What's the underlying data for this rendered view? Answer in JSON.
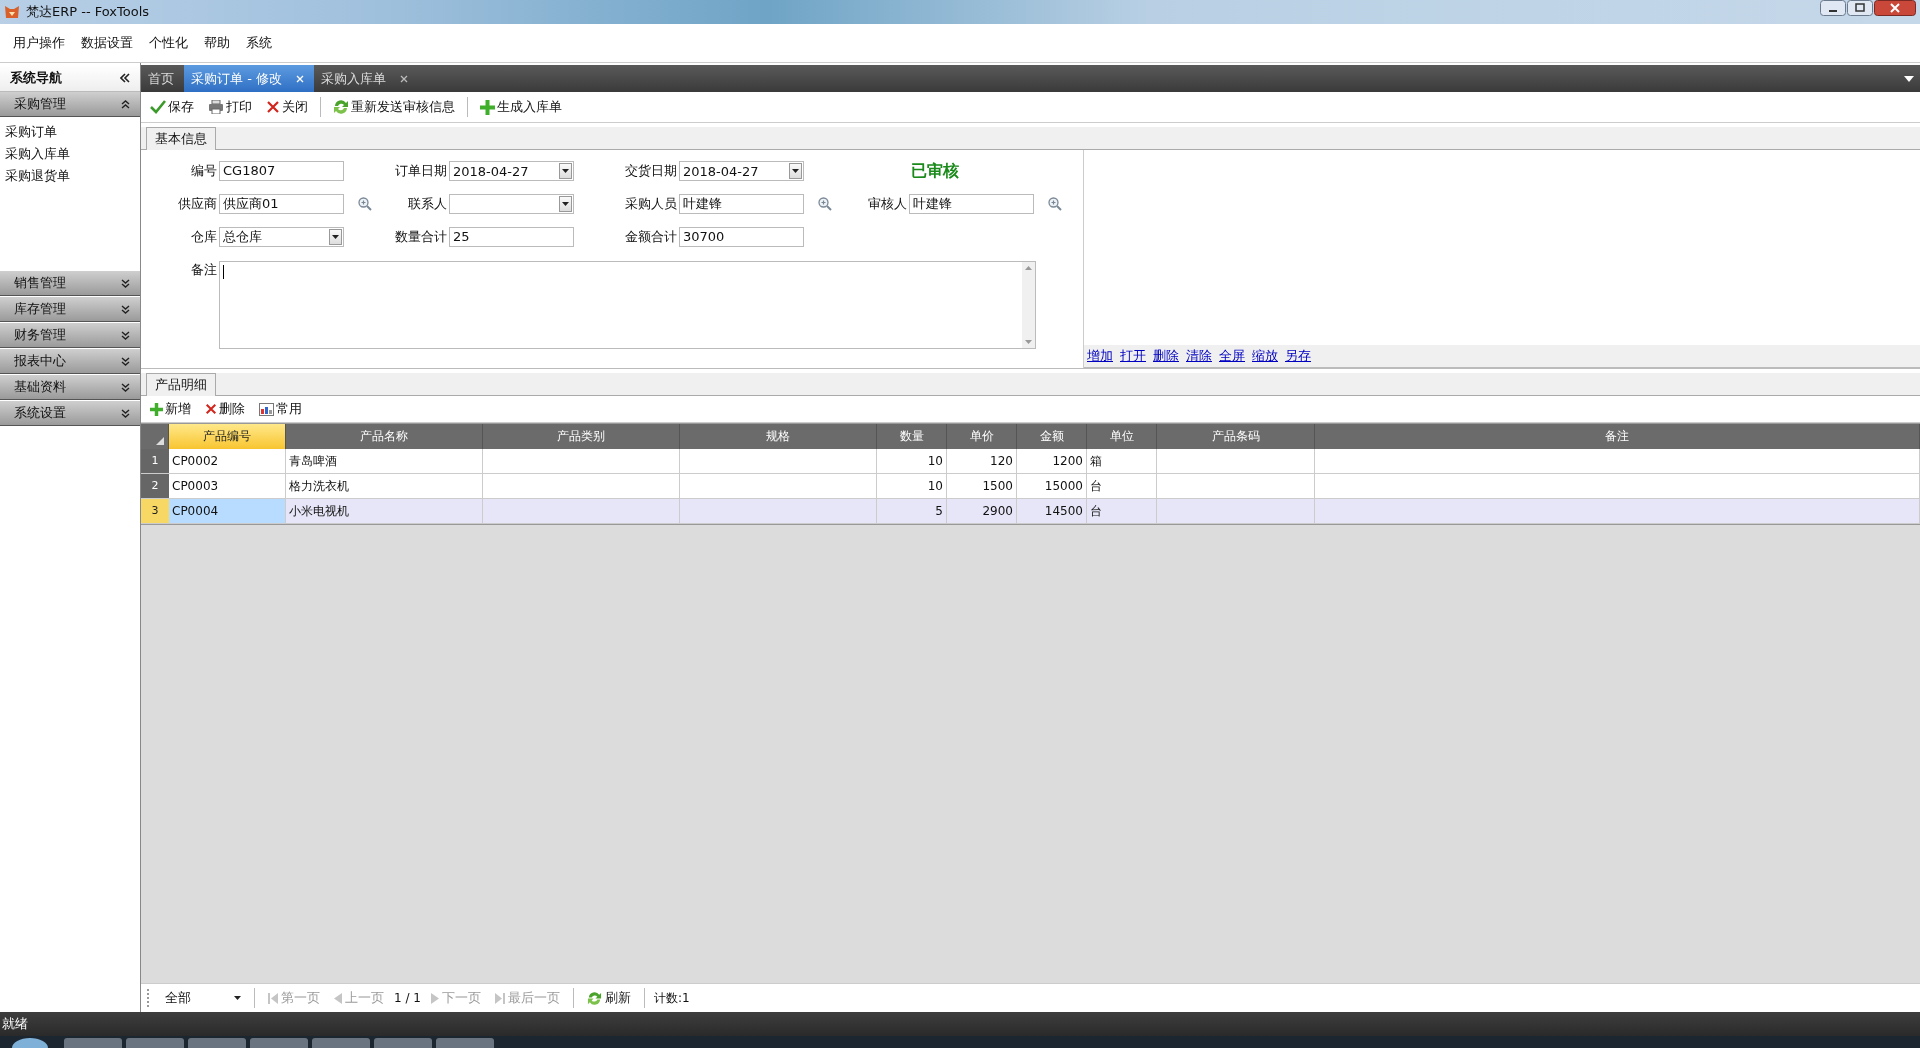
{
  "window": {
    "title": "梵达ERP -- FoxTools"
  },
  "menu": [
    "用户操作",
    "数据设置",
    "个性化",
    "帮助",
    "系统"
  ],
  "sidebar": {
    "title": "系统导航",
    "groups": [
      {
        "label": "采购管理",
        "expanded": true,
        "items": [
          "采购订单",
          "采购入库单",
          "采购退货单"
        ]
      },
      {
        "label": "销售管理",
        "expanded": false
      },
      {
        "label": "库存管理",
        "expanded": false
      },
      {
        "label": "财务管理",
        "expanded": false
      },
      {
        "label": "报表中心",
        "expanded": false
      },
      {
        "label": "基础资料",
        "expanded": false
      },
      {
        "label": "系统设置",
        "expanded": false
      }
    ]
  },
  "tabs": [
    {
      "label": "首页",
      "selected": false,
      "closable": false
    },
    {
      "label": "采购订单 - 修改",
      "selected": true,
      "closable": true
    },
    {
      "label": "采购入库单",
      "selected": false,
      "closable": true
    }
  ],
  "toolbar": {
    "groups": [
      [
        {
          "label": "保存",
          "kind": "save"
        },
        {
          "label": "打印",
          "kind": "print"
        },
        {
          "label": "关闭",
          "kind": "close"
        }
      ],
      [
        {
          "label": "重新发送审核信息",
          "kind": "refresh"
        }
      ],
      [
        {
          "label": "生成入库单",
          "kind": "add"
        }
      ]
    ]
  },
  "form": {
    "tab": "基本信息",
    "rows": [
      [
        {
          "label": "编号",
          "kind": "text",
          "value": "CG1807"
        },
        {
          "label": "订单日期",
          "kind": "combo",
          "value": "2018-04-27"
        },
        {
          "label": "交货日期",
          "kind": "combo",
          "value": "2018-04-27"
        },
        {
          "kind": "status",
          "value": "已审核"
        }
      ],
      [
        {
          "label": "供应商",
          "kind": "lookup",
          "value": "供应商01"
        },
        {
          "label": "联系人",
          "kind": "combo"
        },
        {
          "label": "采购人员",
          "kind": "lookup",
          "value": "叶建锋"
        },
        {
          "label": "审核人",
          "kind": "lookup",
          "value": "叶建锋"
        }
      ],
      [
        {
          "label": "仓库",
          "kind": "combo",
          "value": "总仓库"
        },
        {
          "label": "数量合计",
          "kind": "text",
          "value": "25"
        },
        {
          "label": "金额合计",
          "kind": "text",
          "value": "30700"
        }
      ]
    ],
    "remark": {
      "label": "备注"
    }
  },
  "attachments": {
    "links": [
      "增加",
      "打开",
      "删除",
      "清除",
      "全屏",
      "缩放",
      "另存"
    ]
  },
  "detail": {
    "tab": "产品明细",
    "toolbar": [
      {
        "label": "新增",
        "kind": "add"
      },
      {
        "label": "删除",
        "kind": "delete"
      },
      {
        "label": "常用",
        "kind": "grid"
      }
    ],
    "columns": [
      {
        "label": "产品编号",
        "kind": "text",
        "selected": true
      },
      {
        "label": "产品名称",
        "kind": "text",
        "selected": false
      },
      {
        "label": "产品类别",
        "kind": "text",
        "selected": false
      },
      {
        "label": "规格",
        "kind": "text",
        "selected": false
      },
      {
        "label": "数量",
        "kind": "number",
        "selected": false
      },
      {
        "label": "单价",
        "kind": "number",
        "selected": false
      },
      {
        "label": "金额",
        "kind": "number",
        "selected": false
      },
      {
        "label": "单位",
        "kind": "text",
        "selected": false
      },
      {
        "label": "产品条码",
        "kind": "text",
        "selected": false
      },
      {
        "label": "备注",
        "kind": "text",
        "selected": false
      }
    ],
    "rows": [
      {
        "index": "1",
        "selected": false,
        "cells": [
          "CP0002",
          "青岛啤酒",
          null,
          null,
          "10",
          "120",
          "1200",
          "箱",
          null,
          null
        ]
      },
      {
        "index": "2",
        "selected": false,
        "cells": [
          "CP0003",
          "格力洗衣机",
          null,
          null,
          "10",
          "1500",
          "15000",
          "台",
          null,
          null
        ]
      },
      {
        "index": "3",
        "selected": true,
        "cells": [
          "CP0004",
          "小米电视机",
          null,
          null,
          "5",
          "2900",
          "14500",
          "台",
          null,
          null
        ]
      }
    ]
  },
  "pager": {
    "scope": "全部",
    "nav": [
      {
        "label": "第一页",
        "kind": "first",
        "disabled": true
      },
      {
        "label": "上一页",
        "kind": "prev",
        "disabled": true
      },
      {
        "label": "1 / 1",
        "kind": "page"
      },
      {
        "label": "下一页",
        "kind": "next",
        "disabled": true
      },
      {
        "label": "最后一页",
        "kind": "last",
        "disabled": true
      }
    ],
    "refresh": "刷新",
    "count": "计数:1"
  },
  "status_bar": {
    "text": "就绪"
  }
}
